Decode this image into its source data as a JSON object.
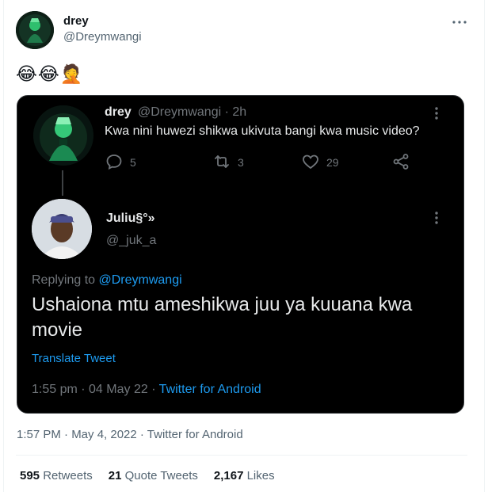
{
  "author": {
    "name": "drey",
    "handle": "@Dreymwangi"
  },
  "tweet": {
    "emoji_text": "😂😂🤦",
    "timestamp": "1:57 PM · May 4, 2022 · Twitter for Android"
  },
  "quoted_card": {
    "original": {
      "name": "drey",
      "handle": "@Dreymwangi",
      "separator": "·",
      "time": "2h",
      "text": "Kwa nini huwezi shikwa ukivuta bangi kwa music video?",
      "replies": "5",
      "retweets": "3",
      "likes": "29"
    },
    "reply": {
      "name": "Juliu§°»",
      "handle": "@_juk_a",
      "replying_prefix": "Replying to ",
      "replying_to": "@Dreymwangi",
      "text": "Ushaiona mtu ameshikwa juu ya kuuana kwa movie",
      "translate": "Translate Tweet",
      "meta_time": "1:55 pm · 04 May 22 · ",
      "meta_source": "Twitter for Android"
    }
  },
  "stats": {
    "retweets_count": "595",
    "retweets_label": "Retweets",
    "quotes_count": "21",
    "quotes_label": "Quote Tweets",
    "likes_count": "2,167",
    "likes_label": "Likes"
  },
  "colors": {
    "accent": "#1d9bf0",
    "card_bg": "#000000",
    "secondary_text": "#536471"
  }
}
